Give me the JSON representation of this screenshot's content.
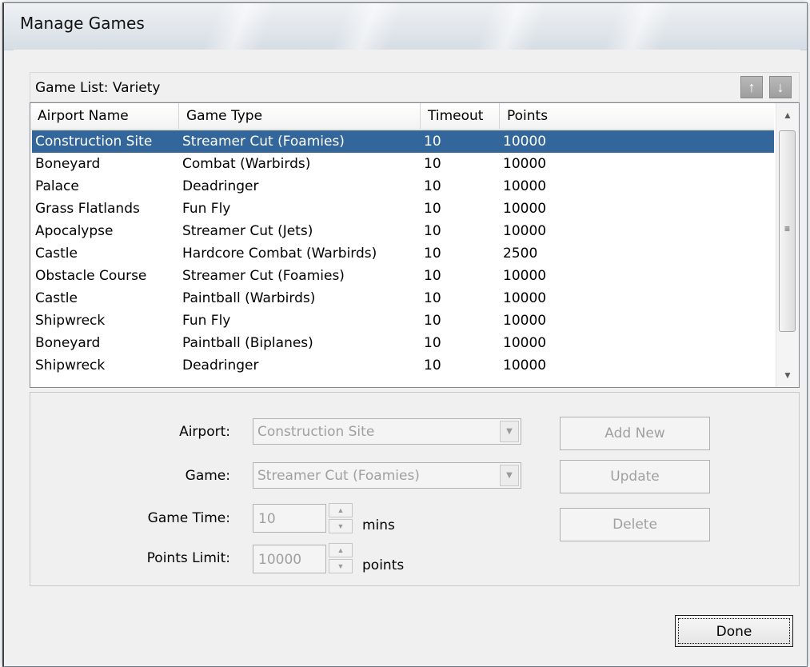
{
  "window": {
    "title": "Manage Games"
  },
  "game_list": {
    "label": "Game List: Variety",
    "move_up_glyph": "↑",
    "move_down_glyph": "↓"
  },
  "table": {
    "columns": [
      "Airport Name",
      "Game Type",
      "Timeout",
      "Points"
    ],
    "selected_index": 0,
    "rows": [
      [
        "Construction Site",
        "Streamer Cut (Foamies)",
        "10",
        "10000"
      ],
      [
        "Boneyard",
        "Combat (Warbirds)",
        "10",
        "10000"
      ],
      [
        "Palace",
        "Deadringer",
        "10",
        "10000"
      ],
      [
        "Grass Flatlands",
        "Fun Fly",
        "10",
        "10000"
      ],
      [
        "Apocalypse",
        "Streamer Cut (Jets)",
        "10",
        "10000"
      ],
      [
        "Castle",
        "Hardcore Combat (Warbirds)",
        "10",
        "2500"
      ],
      [
        "Obstacle Course",
        "Streamer Cut (Foamies)",
        "10",
        "10000"
      ],
      [
        "Castle",
        "Paintball (Warbirds)",
        "10",
        "10000"
      ],
      [
        "Shipwreck",
        "Fun Fly",
        "10",
        "10000"
      ],
      [
        "Boneyard",
        "Paintball (Biplanes)",
        "10",
        "10000"
      ],
      [
        "Shipwreck",
        "Deadringer",
        "10",
        "10000"
      ]
    ]
  },
  "form": {
    "airport_label": "Airport:",
    "airport_value": "Construction Site",
    "game_label": "Game:",
    "game_value": "Streamer Cut (Foamies)",
    "game_time_label": "Game Time:",
    "game_time_value": "10",
    "game_time_unit": "mins",
    "points_limit_label": "Points Limit:",
    "points_limit_value": "10000",
    "points_limit_unit": "points"
  },
  "buttons": {
    "add_new": "Add New",
    "update": "Update",
    "delete": "Delete",
    "done": "Done"
  },
  "colors": {
    "selection": "#33669a",
    "disabled_text": "#a0a0a0"
  }
}
